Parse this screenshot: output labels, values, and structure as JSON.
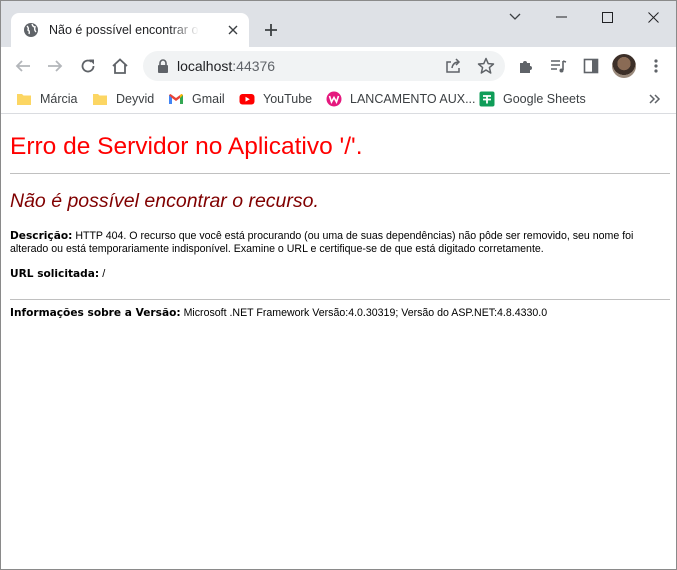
{
  "browser": {
    "tab": {
      "title": "Não é possível encontrar o recurso."
    },
    "url": {
      "host": "localhost",
      "port": ":44376"
    },
    "bookmarks": [
      {
        "label": "Márcia",
        "icon": "folder-icon"
      },
      {
        "label": "Deyvid",
        "icon": "folder-icon"
      },
      {
        "label": "Gmail",
        "icon": "gmail-icon"
      },
      {
        "label": "YouTube",
        "icon": "youtube-icon"
      },
      {
        "label": "LANCAMENTO AUX...",
        "icon": "wamp-icon"
      },
      {
        "label": "Google Sheets",
        "icon": "google-sheets-icon"
      }
    ]
  },
  "page": {
    "server_error": "Erro de Servidor no Aplicativo '/'.",
    "resource_error": "Não é possível encontrar o recurso.",
    "description_label": "Descrição:",
    "description_text": " HTTP 404. O recurso que você está procurando (ou uma de suas dependências) não pôde ser removido, seu nome foi alterado ou está temporariamente indisponível. Examine o URL e certifique-se de que está digitado corretamente.",
    "requested_url_label": "URL solicitada:",
    "requested_url_value": " /",
    "version_label": "Informações sobre a Versão:",
    "version_text": " Microsoft .NET Framework Versão:4.0.30319; Versão do ASP.NET:4.8.4330.0"
  },
  "colors": {
    "error_title": "#ff0000",
    "error_subtitle": "#800000",
    "tabstrip": "#dee1e6",
    "omnibox": "#f1f3f4"
  }
}
